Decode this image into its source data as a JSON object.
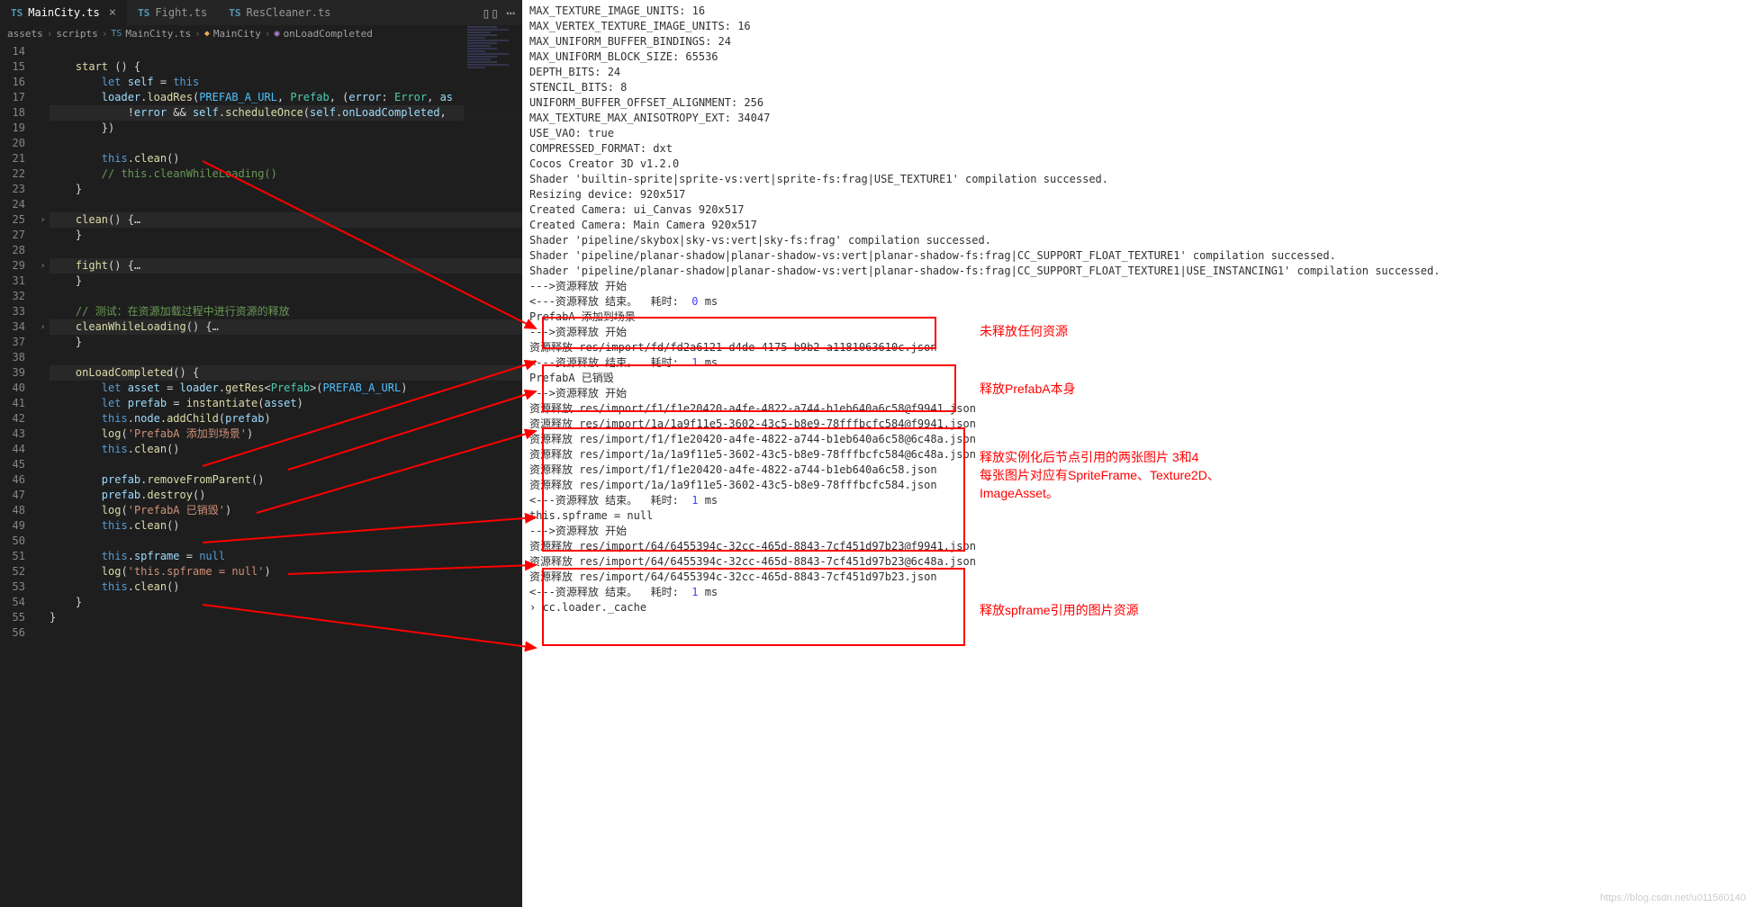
{
  "tabs": [
    {
      "icon": "TS",
      "label": "MainCity.ts",
      "active": true,
      "close": true
    },
    {
      "icon": "TS",
      "label": "Fight.ts",
      "active": false,
      "close": false
    },
    {
      "icon": "TS",
      "label": "ResCleaner.ts",
      "active": false,
      "close": false
    }
  ],
  "breadcrumbs": [
    "assets",
    "scripts",
    "MainCity.ts",
    "MainCity",
    "onLoadCompleted"
  ],
  "code_lines": [
    {
      "n": 14,
      "html": ""
    },
    {
      "n": 15,
      "html": "    <span class='fn'>start</span> () {"
    },
    {
      "n": 16,
      "html": "        <span class='kw'>let</span> <span class='var'>self</span> = <span class='kw'>this</span>"
    },
    {
      "n": 17,
      "html": "        <span class='var'>loader</span>.<span class='fn'>loadRes</span>(<span class='const'>PREFAB_A_URL</span>, <span class='type'>Prefab</span>, (<span class='var'>error</span>: <span class='type'>Error</span>, <span class='var'>as</span>"
    },
    {
      "n": 18,
      "html": "            !<span class='var'>error</span> && <span class='var'>self</span>.<span class='fn'>scheduleOnce</span>(<span class='var'>self</span>.<span class='var'>onLoadCompleted</span>,",
      "hl": true
    },
    {
      "n": 19,
      "html": "        })"
    },
    {
      "n": 20,
      "html": ""
    },
    {
      "n": 21,
      "html": "        <span class='kw'>this</span>.<span class='fn'>clean</span>()"
    },
    {
      "n": 22,
      "html": "        <span class='cmt'>// this.cleanWhileLoading()</span>"
    },
    {
      "n": 23,
      "html": "    }"
    },
    {
      "n": 24,
      "html": ""
    },
    {
      "n": 25,
      "html": "    <span class='fn'>clean</span>() {<span class='punct'>…</span>",
      "hl": true,
      "fold": true
    },
    {
      "n": 27,
      "html": "    }"
    },
    {
      "n": 28,
      "html": ""
    },
    {
      "n": 29,
      "html": "    <span class='fn'>fight</span>() {<span class='punct'>…</span>",
      "hl": true,
      "fold": true
    },
    {
      "n": 31,
      "html": "    }"
    },
    {
      "n": 32,
      "html": ""
    },
    {
      "n": 33,
      "html": "    <span class='cmt'>// 测试：在资源加载过程中进行资源的释放</span>"
    },
    {
      "n": 34,
      "html": "    <span class='fn'>cleanWhileLoading</span>() {<span class='punct'>…</span>",
      "hl": true,
      "fold": true
    },
    {
      "n": 37,
      "html": "    }"
    },
    {
      "n": 38,
      "html": ""
    },
    {
      "n": 39,
      "html": "    <span class='fn'>onLoadCompleted</span>() {",
      "hl": true
    },
    {
      "n": 40,
      "html": "        <span class='kw'>let</span> <span class='var'>asset</span> = <span class='var'>loader</span>.<span class='fn'>getRes</span>&lt;<span class='type'>Prefab</span>&gt;(<span class='const'>PREFAB_A_URL</span>)"
    },
    {
      "n": 41,
      "html": "        <span class='kw'>let</span> <span class='var'>prefab</span> = <span class='fn'>instantiate</span>(<span class='var'>asset</span>)"
    },
    {
      "n": 42,
      "html": "        <span class='kw'>this</span>.<span class='var'>node</span>.<span class='fn'>addChild</span>(<span class='var'>prefab</span>)"
    },
    {
      "n": 43,
      "html": "        <span class='fn'>log</span>(<span class='str'>'PrefabA 添加到场景'</span>)"
    },
    {
      "n": 44,
      "html": "        <span class='kw'>this</span>.<span class='fn'>clean</span>()"
    },
    {
      "n": 45,
      "html": ""
    },
    {
      "n": 46,
      "html": "        <span class='var'>prefab</span>.<span class='fn'>removeFromParent</span>()"
    },
    {
      "n": 47,
      "html": "        <span class='var'>prefab</span>.<span class='fn'>destroy</span>()"
    },
    {
      "n": 48,
      "html": "        <span class='fn'>log</span>(<span class='str'>'PrefabA 已销毁'</span>)"
    },
    {
      "n": 49,
      "html": "        <span class='kw'>this</span>.<span class='fn'>clean</span>()"
    },
    {
      "n": 50,
      "html": ""
    },
    {
      "n": 51,
      "html": "        <span class='kw'>this</span>.<span class='var'>spframe</span> = <span class='kw'>null</span>"
    },
    {
      "n": 52,
      "html": "        <span class='fn'>log</span>(<span class='str'>'this.spframe = null'</span>)"
    },
    {
      "n": 53,
      "html": "        <span class='kw'>this</span>.<span class='fn'>clean</span>()"
    },
    {
      "n": 54,
      "html": "    }"
    },
    {
      "n": 55,
      "html": "}"
    },
    {
      "n": 56,
      "html": ""
    }
  ],
  "console": [
    "MAX_TEXTURE_IMAGE_UNITS: 16",
    "MAX_VERTEX_TEXTURE_IMAGE_UNITS: 16",
    "MAX_UNIFORM_BUFFER_BINDINGS: 24",
    "MAX_UNIFORM_BLOCK_SIZE: 65536",
    "DEPTH_BITS: 24",
    "STENCIL_BITS: 8",
    "UNIFORM_BUFFER_OFFSET_ALIGNMENT: 256",
    "MAX_TEXTURE_MAX_ANISOTROPY_EXT: 34047",
    "USE_VAO: true",
    "COMPRESSED_FORMAT: dxt",
    "Cocos Creator 3D v1.2.0",
    "Shader 'builtin-sprite|sprite-vs:vert|sprite-fs:frag|USE_TEXTURE1' compilation successed.",
    "Resizing device: 920x517",
    "Created Camera: ui_Canvas 920x517",
    "Created Camera: Main Camera 920x517",
    "Shader 'pipeline/skybox|sky-vs:vert|sky-fs:frag' compilation successed.",
    "Shader 'pipeline/planar-shadow|planar-shadow-vs:vert|planar-shadow-fs:frag|CC_SUPPORT_FLOAT_TEXTURE1' compilation successed.",
    "Shader 'pipeline/planar-shadow|planar-shadow-vs:vert|planar-shadow-fs:frag|CC_SUPPORT_FLOAT_TEXTURE1|USE_INSTANCING1' compilation successed."
  ],
  "box1": [
    "--->资源释放 开始",
    "<---资源释放 结束。  耗时:  <span class='num'>0</span> ms"
  ],
  "box2_pre": "PrefabA 添加到场景",
  "box2": [
    "--->资源释放 开始",
    "资源释放 res/import/fd/fd2a6121-d4de-4175-b9b2-a1181063610c.json",
    "<---资源释放 结束。  耗时:  <span class='num'>1</span> ms"
  ],
  "box3_pre": "PrefabA 已销毁",
  "box3": [
    "--->资源释放 开始",
    "资源释放 res/import/f1/f1e20420-a4fe-4822-a744-b1eb640a6c58@f9941.json",
    "资源释放 res/import/1a/1a9f11e5-3602-43c5-b8e9-78fffbcfc584@f9941.json",
    "资源释放 res/import/f1/f1e20420-a4fe-4822-a744-b1eb640a6c58@6c48a.json",
    "资源释放 res/import/1a/1a9f11e5-3602-43c5-b8e9-78fffbcfc584@6c48a.json",
    "资源释放 res/import/f1/f1e20420-a4fe-4822-a744-b1eb640a6c58.json",
    "资源释放 res/import/1a/1a9f11e5-3602-43c5-b8e9-78fffbcfc584.json",
    "<---资源释放 结束。  耗时:  <span class='num'>1</span> ms"
  ],
  "box4_pre": "this.spframe = null",
  "box4": [
    "--->资源释放 开始",
    "资源释放 res/import/64/6455394c-32cc-465d-8843-7cf451d97b23@f9941.json",
    "资源释放 res/import/64/6455394c-32cc-465d-8843-7cf451d97b23@6c48a.json",
    "资源释放 res/import/64/6455394c-32cc-465d-8843-7cf451d97b23.json",
    "<---资源释放 结束。  耗时:  <span class='num'>1</span> ms"
  ],
  "box5_post": "cc.loader._cache",
  "annotations": {
    "a1": "未释放任何资源",
    "a2": "释放PrefabA本身",
    "a3": "释放实例化后节点引用的两张图片 3和4\n每张图片对应有SpriteFrame、Texture2D、\nImageAsset。",
    "a4": "释放spframe引用的图片资源"
  },
  "watermark": "https://blog.csdn.net/u011560140"
}
